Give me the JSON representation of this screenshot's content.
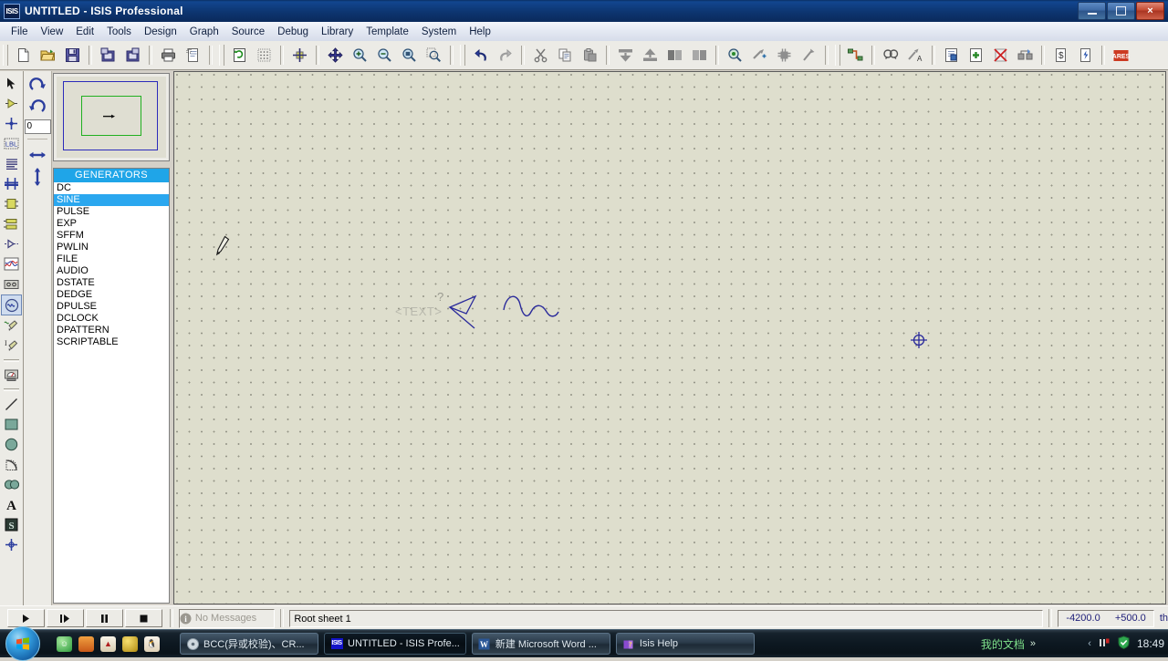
{
  "window": {
    "title": "UNTITLED - ISIS Professional",
    "icon_label": "ISIS",
    "controls": {
      "minimize": "minimize-button",
      "maximize": "maximize-button",
      "close": "×"
    }
  },
  "menu": {
    "items": [
      "File",
      "View",
      "Edit",
      "Tools",
      "Design",
      "Graph",
      "Source",
      "Debug",
      "Library",
      "Template",
      "System",
      "Help"
    ]
  },
  "toolbar": {
    "groups": [
      {
        "name": "file",
        "buttons": [
          {
            "icon": "new-file-icon",
            "label": "New"
          },
          {
            "icon": "open-folder-icon",
            "label": "Open"
          },
          {
            "icon": "save-icon",
            "label": "Save"
          },
          {
            "icon": "import-section-icon",
            "label": "Import Section"
          },
          {
            "icon": "export-section-icon",
            "label": "Export Section"
          },
          {
            "icon": "print-icon",
            "label": "Print"
          },
          {
            "icon": "print-area-icon",
            "label": "Print Area"
          }
        ]
      },
      {
        "name": "view",
        "buttons": [
          {
            "icon": "redraw-icon",
            "label": "Redraw"
          },
          {
            "icon": "grid-toggle-icon",
            "label": "Toggle Grid"
          },
          {
            "icon": "origin-icon",
            "label": "Toggle Origin"
          },
          {
            "icon": "pan-icon",
            "label": "Pan"
          },
          {
            "icon": "zoom-in-icon",
            "label": "Zoom In"
          },
          {
            "icon": "zoom-out-icon",
            "label": "Zoom Out"
          },
          {
            "icon": "zoom-all-icon",
            "label": "Zoom to View Entire Sheet"
          },
          {
            "icon": "zoom-area-icon",
            "label": "Zoom to Area"
          }
        ]
      },
      {
        "name": "edit",
        "buttons": [
          {
            "icon": "undo-icon",
            "label": "Undo"
          },
          {
            "icon": "redo-icon",
            "label": "Redo"
          },
          {
            "icon": "cut-icon",
            "label": "Cut to Clipboard"
          },
          {
            "icon": "copy-icon",
            "label": "Copy to Clipboard"
          },
          {
            "icon": "paste-icon",
            "label": "Paste from Clipboard"
          },
          {
            "icon": "block-copy-icon",
            "label": "Block Copy"
          },
          {
            "icon": "block-move-icon",
            "label": "Block Move"
          },
          {
            "icon": "block-rotate-icon",
            "label": "Block Rotate"
          },
          {
            "icon": "block-delete-icon",
            "label": "Block Delete"
          },
          {
            "icon": "pick-device-icon",
            "label": "Pick Device"
          },
          {
            "icon": "make-device-icon",
            "label": "Make Device"
          },
          {
            "icon": "packaging-tool-icon",
            "label": "Packaging Tool"
          },
          {
            "icon": "decompose-icon",
            "label": "Decompose"
          }
        ]
      },
      {
        "name": "design",
        "buttons": [
          {
            "icon": "wire-autorouter-icon",
            "label": "Wire Auto Router"
          },
          {
            "icon": "search-tag-icon",
            "label": "Search and Tag"
          },
          {
            "icon": "property-assignment-icon",
            "label": "Property Assignment Tool"
          },
          {
            "icon": "design-explorer-icon",
            "label": "Design Explorer"
          },
          {
            "icon": "new-sheet-icon",
            "label": "New Sheet"
          },
          {
            "icon": "remove-sheet-icon",
            "label": "Remove/Delete Sheet"
          },
          {
            "icon": "exit-sheet-icon",
            "label": "Exit to Parent Sheet"
          },
          {
            "icon": "bill-of-materials-icon",
            "label": "Bill of Materials"
          },
          {
            "icon": "electrical-rules-icon",
            "label": "Electrical Rules Check"
          },
          {
            "icon": "ares-icon",
            "label": "ARES"
          }
        ]
      }
    ]
  },
  "left_tools": {
    "items": [
      {
        "icon": "selection-mode-icon",
        "label": "Selection Mode",
        "selected": false
      },
      {
        "icon": "component-mode-icon",
        "label": "Component Mode",
        "selected": false
      },
      {
        "icon": "junction-dot-icon",
        "label": "Junction Dot Mode",
        "selected": false
      },
      {
        "icon": "wire-label-icon",
        "label": "Wire Label Mode",
        "selected": false
      },
      {
        "icon": "text-script-icon",
        "label": "Text Script Mode",
        "selected": false
      },
      {
        "icon": "bus-icon",
        "label": "Buses Mode",
        "selected": false
      },
      {
        "icon": "subcircuit-icon",
        "label": "Subcircuit Mode",
        "selected": false
      },
      {
        "icon": "terminals-icon",
        "label": "Terminals Mode",
        "selected": false
      },
      {
        "icon": "device-pin-icon",
        "label": "Device Pins Mode",
        "selected": false
      },
      {
        "icon": "graph-icon",
        "label": "Graph Mode",
        "selected": false
      },
      {
        "icon": "tape-recorder-icon",
        "label": "Tape Recorder Mode",
        "selected": false
      },
      {
        "icon": "generator-icon",
        "label": "Generator Mode",
        "selected": true
      },
      {
        "icon": "voltage-probe-icon",
        "label": "Voltage Probe Mode",
        "selected": false
      },
      {
        "icon": "current-probe-icon",
        "label": "Current Probe Mode",
        "selected": false
      },
      {
        "icon": "virtual-instrument-icon",
        "label": "Virtual Instruments Mode",
        "selected": false
      },
      {
        "icon": "line-tool-icon",
        "label": "2D Graphics Line Mode",
        "selected": false
      },
      {
        "icon": "box-tool-icon",
        "label": "2D Graphics Box Mode",
        "selected": false
      },
      {
        "icon": "circle-tool-icon",
        "label": "2D Graphics Circle Mode",
        "selected": false
      },
      {
        "icon": "arc-tool-icon",
        "label": "2D Graphics Arc Mode",
        "selected": false
      },
      {
        "icon": "path-tool-icon",
        "label": "2D Graphics Closed Path Mode",
        "selected": false
      },
      {
        "icon": "text-tool-icon",
        "label": "2D Graphics Text Mode",
        "selected": false
      },
      {
        "icon": "symbol-tool-icon",
        "label": "2D Graphics Symbols Mode",
        "selected": false
      },
      {
        "icon": "marker-tool-icon",
        "label": "2D Graphics Markers Mode",
        "selected": false
      }
    ]
  },
  "orientation": {
    "rotate_cw": "rotate-clockwise-icon",
    "rotate_ccw": "rotate-anticlockwise-icon",
    "angle_value": "0",
    "mirror_x": "mirror-horizontal-icon",
    "mirror_y": "mirror-vertical-icon"
  },
  "preview": {
    "label": "object-preview"
  },
  "generators": {
    "header": "GENERATORS",
    "items": [
      "DC",
      "SINE",
      "PULSE",
      "EXP",
      "SFFM",
      "PWLIN",
      "FILE",
      "AUDIO",
      "DSTATE",
      "DEDGE",
      "DPULSE",
      "DCLOCK",
      "DPATTERN",
      "SCRIPTABLE"
    ],
    "selected": "SINE"
  },
  "canvas": {
    "text_placeholder": "<TEXT>",
    "question_mark": "?",
    "pen_cursor": "pen-cursor-icon",
    "origin_marker": "origin-crosshair-icon"
  },
  "status": {
    "animation_buttons": [
      {
        "icon": "play-icon",
        "label": "Play"
      },
      {
        "icon": "step-icon",
        "label": "Step"
      },
      {
        "icon": "pause-icon",
        "label": "Pause"
      },
      {
        "icon": "stop-icon",
        "label": "Stop"
      }
    ],
    "message": "No Messages",
    "message_icon": "info-icon",
    "sheet": "Root sheet 1",
    "coord_x": "-4200.0",
    "coord_y": "+500.0",
    "units": "th"
  },
  "taskbar": {
    "start": "start-orb",
    "quick_launch": [
      {
        "icon": "qq-green-icon",
        "label": "QQ"
      },
      {
        "icon": "orange-app-icon",
        "label": "Media"
      },
      {
        "icon": "reader-icon",
        "label": "Reader"
      },
      {
        "icon": "yellow-app-icon",
        "label": "App"
      },
      {
        "icon": "penguin-icon",
        "label": "QQ Messenger"
      }
    ],
    "tasks": [
      {
        "icon": "disc-icon",
        "label": "BCC(异或校验)、CR...",
        "active": false
      },
      {
        "icon": "isis-icon",
        "label": "UNTITLED - ISIS Profe...",
        "active": true
      },
      {
        "icon": "word-icon",
        "label": "新建 Microsoft Word ...",
        "active": false
      },
      {
        "icon": "help-book-icon",
        "label": "Isis Help",
        "active": false
      }
    ],
    "deskband": "我的文档",
    "deskband_chevron": "»",
    "tray": [
      {
        "icon": "tray-chevron-icon",
        "label": "Show hidden icons"
      },
      {
        "icon": "network-icon",
        "label": "Network"
      },
      {
        "icon": "shield-icon",
        "label": "Security"
      }
    ],
    "clock": "18:49"
  },
  "colors": {
    "title_blue": "#0d3570",
    "accent_cyan": "#1fa5e8",
    "select_blue": "#2aa7ef",
    "canvas_bg": "#dedecd",
    "chrome": "#ecebe6",
    "ink_blue": "#2b2b9b"
  }
}
